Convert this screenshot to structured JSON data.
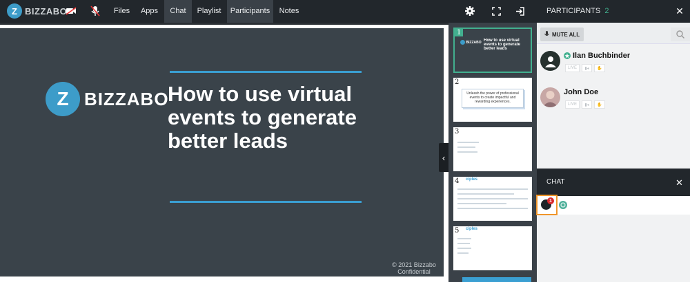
{
  "app": {
    "logo_text": "BIZZABO",
    "logo_letter": "Z"
  },
  "nav": {
    "items": [
      {
        "label": "Files",
        "active": false
      },
      {
        "label": "Apps",
        "active": false
      },
      {
        "label": "Chat",
        "active": true
      },
      {
        "label": "Playlist",
        "active": false
      },
      {
        "label": "Participants",
        "active": true
      },
      {
        "label": "Notes",
        "active": false
      }
    ]
  },
  "participants_panel": {
    "title": "PARTICIPANTS",
    "count": "2",
    "mute_all_label": "MUTE ALL",
    "people": [
      {
        "name": "Ilan Buchbinder",
        "is_host": true,
        "live_label": "LIVE"
      },
      {
        "name": "John Doe",
        "is_host": false,
        "live_label": "LIVE"
      }
    ]
  },
  "slide": {
    "logo_letter": "Z",
    "logo_text": "BIZZABO",
    "title": "How to use virtual events to generate better leads",
    "footer_line1": "© 2021 Bizzabo",
    "footer_line2": "Confidential"
  },
  "thumbnails": [
    {
      "num": "1",
      "title": "How to use virtual events to generate better leads",
      "logo": "BIZZABO"
    },
    {
      "num": "2",
      "text": "Unleash the power of professional events to create impactful and rewarding experiences."
    },
    {
      "num": "3"
    },
    {
      "num": "4",
      "heading": "ciples"
    },
    {
      "num": "5",
      "heading": "ciples"
    }
  ],
  "chat": {
    "title": "CHAT",
    "badge_count": "1"
  },
  "colors": {
    "accent": "#3a9fd2",
    "host_green": "#42b08f",
    "highlight": "#f0962a"
  },
  "icons": [
    "video-off-icon",
    "mic-off-icon",
    "gear-icon",
    "fullscreen-icon",
    "exit-icon",
    "close-icon",
    "search-icon",
    "mic-icon",
    "camera-icon",
    "hand-icon",
    "smile-icon"
  ]
}
